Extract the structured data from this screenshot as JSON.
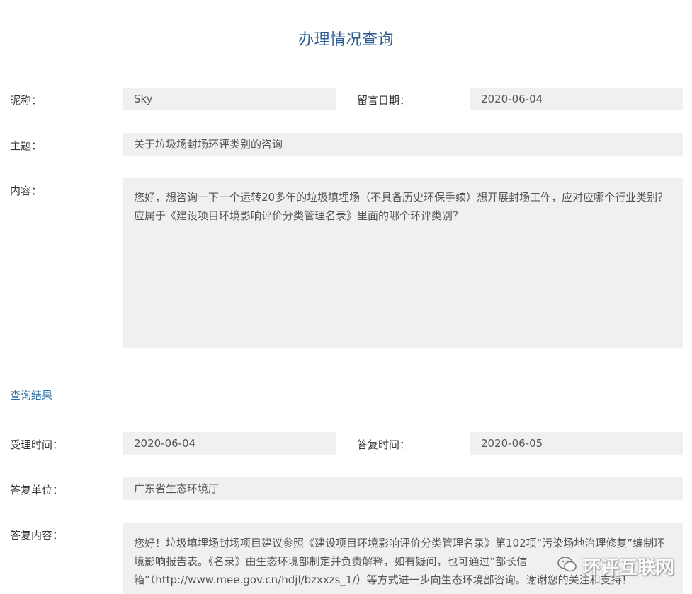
{
  "page_title": "办理情况查询",
  "form": {
    "nickname_label": "昵称：",
    "nickname_value": "Sky",
    "msg_date_label": "留言日期：",
    "msg_date_value": "2020-06-04",
    "subject_label": "主题：",
    "subject_value": "关于垃圾场封场环评类别的咨询",
    "content_label": "内容：",
    "content_value": "您好，想咨询一下一个运转20多年的垃圾填埋场（不具备历史环保手续）想开展封场工作，应对应哪个行业类别？应属于《建设项目环境影响评价分类管理名录》里面的哪个环评类别？"
  },
  "result": {
    "section_title": "查询结果",
    "accept_time_label": "受理时间：",
    "accept_time_value": "2020-06-04",
    "reply_time_label": "答复时间：",
    "reply_time_value": "2020-06-05",
    "reply_unit_label": "答复单位：",
    "reply_unit_value": "广东省生态环境厅",
    "reply_content_label": "答复内容：",
    "reply_content_value": "您好！垃圾填埋场封场项目建议参照《建设项目环境影响评价分类管理名录》第102项“污染场地治理修复”编制环境影响报告表。《名录》由生态环境部制定并负责解释，如有疑问，也可通过“部长信箱”（http://www.mee.gov.cn/hdjl/bzxxzs_1/）等方式进一步向生态环境部咨询。谢谢您的关注和支持！"
  },
  "watermark": {
    "text": "环评互联网",
    "icon": "wechat-icon"
  }
}
